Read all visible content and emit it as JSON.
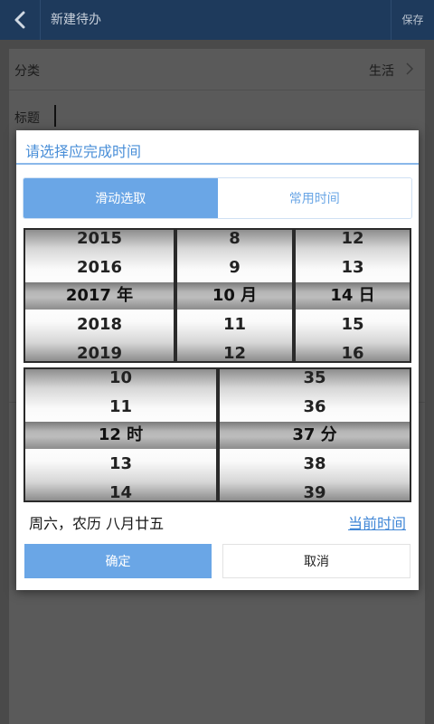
{
  "appbar": {
    "title": "新建待办",
    "save_label": "保存"
  },
  "form": {
    "category_label": "分类",
    "category_value": "生活",
    "title_label": "标题"
  },
  "dialog": {
    "title": "请选择应完成时间",
    "tabs": [
      {
        "label": "滑动选取"
      },
      {
        "label": "常用时间"
      }
    ],
    "date_wheels": {
      "year": [
        "2015",
        "2016",
        "2017 年",
        "2018",
        "2019"
      ],
      "month": [
        "8",
        "9",
        "10 月",
        "11",
        "12"
      ],
      "day": [
        "12",
        "13",
        "14 日",
        "15",
        "16"
      ]
    },
    "time_wheels": {
      "hour": [
        "10",
        "11",
        "12 时",
        "13",
        "14"
      ],
      "minute": [
        "35",
        "36",
        "37 分",
        "38",
        "39"
      ]
    },
    "lunar_text": "周六，农历 八月廿五",
    "now_link": "当前时间",
    "ok_label": "确定",
    "cancel_label": "取消"
  },
  "colors": {
    "accent": "#6aa6e6",
    "header": "#1e3a5c"
  }
}
